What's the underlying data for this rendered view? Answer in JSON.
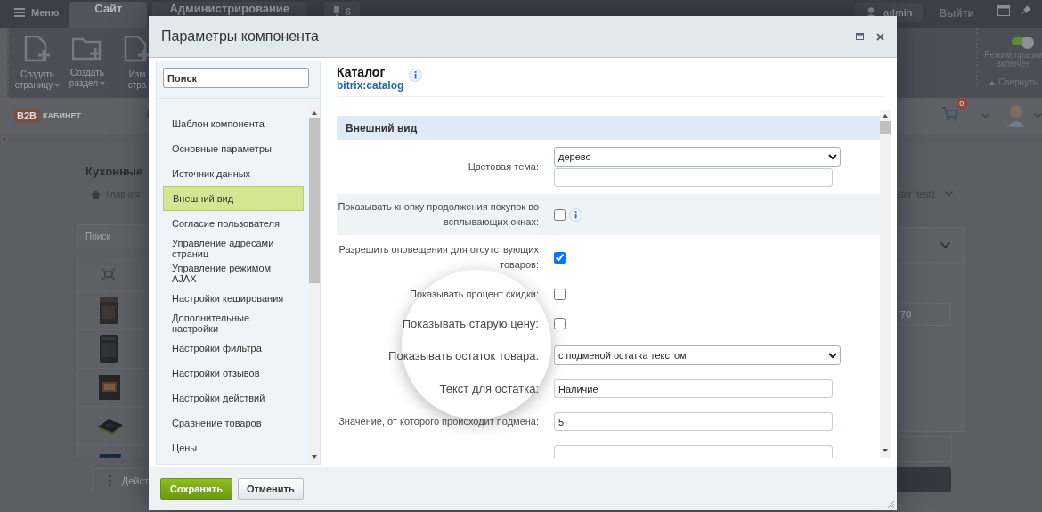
{
  "topbar": {
    "menu": "Меню",
    "tabs": [
      {
        "label": "Сайт",
        "selected": true
      },
      {
        "label": "Администрирование",
        "selected": false
      }
    ],
    "notifications": "6",
    "user": "admin",
    "logout": "Выйти"
  },
  "toolbar": {
    "items": [
      {
        "kind": "page",
        "lines": [
          "Создать",
          "страницу"
        ],
        "caret": true
      },
      {
        "kind": "folder",
        "lines": [
          "Создать",
          "раздел"
        ],
        "caret": true
      },
      {
        "kind": "page",
        "lines": [
          "Изм",
          "стра"
        ],
        "caret": false
      }
    ],
    "edit_mode": {
      "on": true,
      "lines": [
        "Режим правки",
        "включен"
      ],
      "collapse": "Свернуть"
    }
  },
  "site_header": {
    "logo_mark": "B2B",
    "logo_caption": "КАБИНЕТ",
    "cart_count": "0"
  },
  "page": {
    "heading": "Кухонные",
    "breadcrumb": "Главная",
    "search_placeholder": "Поиск",
    "actions_button": "Дейст",
    "user_filter": "ster_test1",
    "quantity": "70"
  },
  "dialog": {
    "title": "Параметры компонента",
    "search_placeholder": "Поиск",
    "nav": [
      {
        "label": "Шаблон компонента",
        "selected": false
      },
      {
        "label": "Основные параметры",
        "selected": false
      },
      {
        "label": "Источник данных",
        "selected": false
      },
      {
        "label": "Внешний вид",
        "selected": true
      },
      {
        "label": "Согласие пользователя",
        "selected": false
      },
      {
        "label": "Управление адресами страниц",
        "selected": false
      },
      {
        "label": "Управление режимом AJAX",
        "selected": false
      },
      {
        "label": "Настройки кеширования",
        "selected": false
      },
      {
        "label": "Дополнительные настройки",
        "selected": false
      },
      {
        "label": "Настройки фильтра",
        "selected": false
      },
      {
        "label": "Настройки отзывов",
        "selected": false
      },
      {
        "label": "Настройки действий",
        "selected": false
      },
      {
        "label": "Сравнение товаров",
        "selected": false
      },
      {
        "label": "Цены",
        "selected": false
      }
    ],
    "component_name": "Каталог",
    "component_code": "bitrix:catalog",
    "section": "Внешний вид",
    "fields": [
      {
        "kind": "select",
        "label": "Цветовая тема:",
        "value": "дерево",
        "custom_input": true,
        "info": false,
        "shaded": false,
        "magnified": false
      },
      {
        "kind": "checkbox",
        "label": "Показывать кнопку продолжения покупок во всплывающих окнах:",
        "checked": false,
        "info": true,
        "shaded": true,
        "magnified": false
      },
      {
        "kind": "checkbox",
        "label": "Разрешить оповещения для отсутствующих товаров:",
        "checked": true,
        "info": false,
        "shaded": false,
        "magnified": false
      },
      {
        "kind": "checkbox",
        "label": "Показывать процент скидки:",
        "checked": false,
        "info": false,
        "shaded": false,
        "magnified": false
      },
      {
        "kind": "checkbox",
        "label": "Показывать старую цену:",
        "checked": false,
        "info": false,
        "shaded": false,
        "magnified": true
      },
      {
        "kind": "select",
        "label": "Показывать остаток товара:",
        "value": "с подменой остатка текстом",
        "custom_input": false,
        "info": false,
        "shaded": false,
        "magnified": true
      },
      {
        "kind": "input",
        "label": "Текст для остатка:",
        "value": "Наличие",
        "info": false,
        "shaded": false,
        "magnified": true
      },
      {
        "kind": "input",
        "label": "Значение, от которого происходит подмена:",
        "value": "5",
        "info": false,
        "shaded": false,
        "magnified": false
      },
      {
        "kind": "input",
        "info": false,
        "shaded": false,
        "magnified": false
      }
    ],
    "buttons": [
      {
        "kind": "primary",
        "label": "Сохранить"
      },
      {
        "kind": "secondary",
        "label": "Отменить"
      }
    ]
  }
}
